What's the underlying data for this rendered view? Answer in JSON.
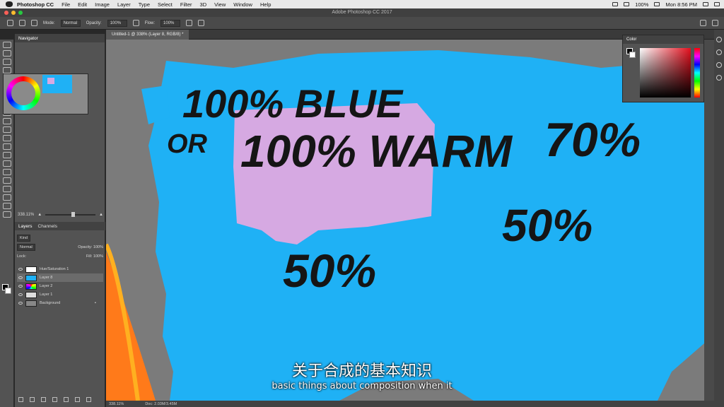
{
  "menubar": {
    "items": [
      "Photoshop CC",
      "File",
      "Edit",
      "Image",
      "Layer",
      "Type",
      "Select",
      "Filter",
      "3D",
      "View",
      "Window",
      "Help"
    ],
    "battery": "100%",
    "clock": "Mon 8:56 PM"
  },
  "window": {
    "title": "Adobe Photoshop CC 2017"
  },
  "options": {
    "mode_label": "Mode:",
    "mode_value": "Normal",
    "opacity_label": "Opacity:",
    "opacity_value": "100%",
    "flow_label": "Flow:",
    "flow_value": "100%"
  },
  "navigator": {
    "title": "Navigator",
    "zoom": "338.11%"
  },
  "layers_panel": {
    "tabs": [
      "Layers",
      "Channels"
    ],
    "kind": "Kind",
    "blend_mode": "Normal",
    "opacity_label": "Opacity:",
    "opacity_value": "100%",
    "lock_label": "Lock:",
    "fill_label": "Fill:",
    "fill_value": "100%",
    "layers": [
      {
        "name": "Hue/Saturation 1",
        "selected": false
      },
      {
        "name": "Layer 8",
        "selected": true
      },
      {
        "name": "Layer 2",
        "selected": false
      },
      {
        "name": "Layer 1",
        "selected": false
      },
      {
        "name": "Background",
        "selected": false
      }
    ]
  },
  "document": {
    "tab_label": "Untitled-1 @ 338% (Layer 8, RGB/8) *",
    "zoom": "338.11%",
    "doc_info": "Doc: 2.03M/3.45M"
  },
  "color_panel": {
    "title": "Color",
    "accent_red": "#e4101e"
  },
  "canvas": {
    "bg_blue": "#1fb1f5",
    "pink": "#d6a9e2",
    "orange": "#ff7a1a",
    "text_lines": [
      "100% BLUE",
      "OR",
      "100% WARM",
      "70%",
      "50%",
      "50%"
    ]
  },
  "subtitles": {
    "chinese": "关于合成的基本知识",
    "english": "basic things about composition when it"
  }
}
